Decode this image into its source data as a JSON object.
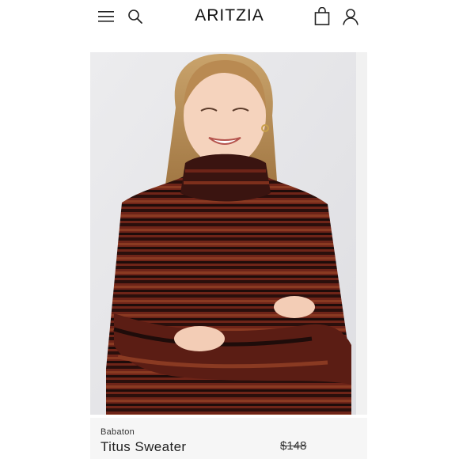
{
  "header": {
    "brand_name": "ARITZIA",
    "menu_icon": "hamburger-menu-icon",
    "search_icon": "search-icon",
    "bag_icon": "shopping-bag-icon",
    "account_icon": "account-icon"
  },
  "product": {
    "image": "model-in-striped-turtleneck-sweater",
    "brand": "Babaton",
    "name": "Titus Sweater",
    "price": "$148"
  },
  "colors": {
    "sweater_primary": "#6e2418",
    "sweater_dark": "#1e0c0a",
    "background": "#e9e9eb"
  }
}
